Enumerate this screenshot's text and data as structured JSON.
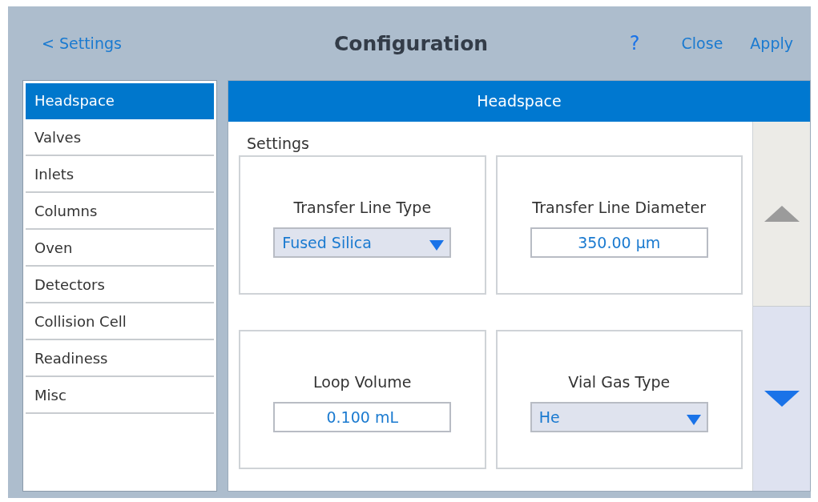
{
  "header": {
    "back": "< Settings",
    "title": "Configuration",
    "help": "?",
    "actions": [
      "Close",
      "Apply"
    ]
  },
  "sidebar": {
    "items": [
      {
        "label": "Headspace",
        "selected": true
      },
      {
        "label": "Valves",
        "selected": false
      },
      {
        "label": "Inlets",
        "selected": false
      },
      {
        "label": "Columns",
        "selected": false
      },
      {
        "label": "Oven",
        "selected": false
      },
      {
        "label": "Detectors",
        "selected": false
      },
      {
        "label": "Collision Cell",
        "selected": false
      },
      {
        "label": "Readiness",
        "selected": false
      },
      {
        "label": "Misc",
        "selected": false
      }
    ]
  },
  "panel": {
    "title": "Headspace",
    "section": "Settings",
    "fields": [
      {
        "label": "Transfer Line Type",
        "kind": "dropdown",
        "value": "Fused Silica"
      },
      {
        "label": "Transfer Line Diameter",
        "kind": "input",
        "value": "350.00 µm"
      },
      {
        "label": "Loop Volume",
        "kind": "input",
        "value": "0.100 mL"
      },
      {
        "label": "Vial Gas Type",
        "kind": "dropdown",
        "value": "He"
      }
    ],
    "scroll": {
      "up_disabled": true,
      "down_disabled": false
    }
  }
}
